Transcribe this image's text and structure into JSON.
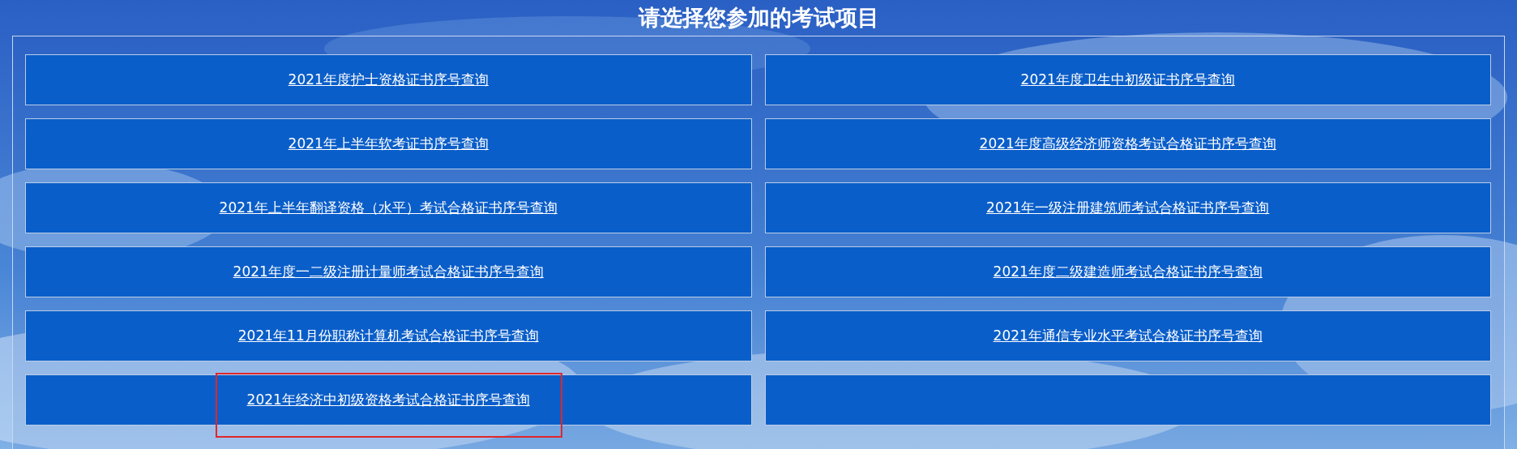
{
  "title": "请选择您参加的考试项目",
  "items": [
    {
      "kind": "link",
      "label": "2021年度护士资格证书序号查询",
      "highlighted": false
    },
    {
      "kind": "link",
      "label": "2021年度卫生中初级证书序号查询",
      "highlighted": false
    },
    {
      "kind": "link",
      "label": "2021年上半年软考证书序号查询",
      "highlighted": false
    },
    {
      "kind": "link",
      "label": "2021年度高级经济师资格考试合格证书序号查询",
      "highlighted": false
    },
    {
      "kind": "link",
      "label": "2021年上半年翻译资格（水平）考试合格证书序号查询",
      "highlighted": false
    },
    {
      "kind": "link",
      "label": "2021年一级注册建筑师考试合格证书序号查询",
      "highlighted": false
    },
    {
      "kind": "link",
      "label": "2021年度一二级注册计量师考试合格证书序号查询",
      "highlighted": false
    },
    {
      "kind": "link",
      "label": "2021年度二级建造师考试合格证书序号查询",
      "highlighted": false
    },
    {
      "kind": "link",
      "label": "2021年11月份职称计算机考试合格证书序号查询",
      "highlighted": false
    },
    {
      "kind": "link",
      "label": "2021年通信专业水平考试合格证书序号查询",
      "highlighted": false
    },
    {
      "kind": "link",
      "label": "2021年经济中初级资格考试合格证书序号查询",
      "highlighted": true
    },
    {
      "kind": "blank"
    }
  ]
}
